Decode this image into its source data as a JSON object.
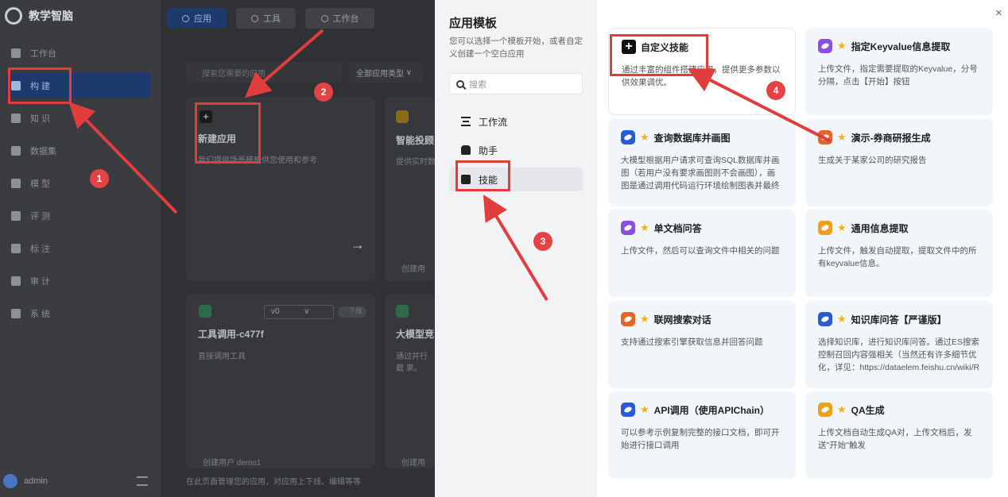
{
  "app": {
    "name": "教学智脑"
  },
  "sidebar": {
    "items": [
      {
        "label": "工作台",
        "icon": "cube-icon",
        "active": false
      },
      {
        "label": "构  建",
        "icon": "build-icon",
        "active": true
      },
      {
        "label": "知  识",
        "icon": "book-icon",
        "active": false
      },
      {
        "label": "数据集",
        "icon": "dataset-icon",
        "active": false
      },
      {
        "label": "模  型",
        "icon": "model-icon",
        "active": false
      },
      {
        "label": "评  测",
        "icon": "chart-icon",
        "active": false
      },
      {
        "label": "标  注",
        "icon": "tag-icon",
        "active": false
      },
      {
        "label": "审  计",
        "icon": "shield-icon",
        "active": false
      },
      {
        "label": "系  统",
        "icon": "gear-icon",
        "active": false
      }
    ],
    "user": "admin"
  },
  "top_tabs": [
    {
      "label": "应用",
      "active": true
    },
    {
      "label": "工具",
      "active": false
    },
    {
      "label": "工作台",
      "active": false
    }
  ],
  "background": {
    "search_placeholder": "搜索您需要的应用",
    "type_filter": "全部应用类型",
    "new_app_title": "新建应用",
    "new_app_desc": "我们提供场景模板供您使用和参考",
    "card2_title": "智能投顾",
    "card2_desc": "提供实时数",
    "card3_title": "工具调用-c477f",
    "card3_desc": "直接调用工具",
    "card3_version": "v0",
    "card3_toggle": "下线",
    "card4_title": "大模型竞",
    "card4_desc": "通过并行截 果。",
    "creator_1": "创建用",
    "creator_2": "创建用户 demo1",
    "creator_3": "创建用",
    "footer": "在此页面管理您的应用，对应用上下线、编辑等等"
  },
  "drawer": {
    "title": "应用模板",
    "subtitle": "您可以选择一个模板开始，或者自定义创建一个空白应用",
    "search_placeholder": "搜索",
    "categories": [
      {
        "label": "工作流",
        "active": false
      },
      {
        "label": "助手",
        "active": false
      },
      {
        "label": "技能",
        "active": true
      }
    ],
    "close_glyph": "×"
  },
  "templates": [
    {
      "title": "自定义技能",
      "desc": "通过丰富的组件搭建应用，提供更多参数以供效果调优。",
      "color": "#111111",
      "star": false,
      "custom": true
    },
    {
      "title": "指定Keyvalue信息提取",
      "desc": "上传文件，指定需要提取的Keyvalue，分号分隔，点击【开始】按钮",
      "color": "#8a4fe0",
      "star": true
    },
    {
      "title": "查询数据库并画图",
      "desc": "大模型根据用户请求可查询SQL数据库并画图（若用户没有要求画图则不会画图），画图是通过调用代码运行环境绘制图表并最终保",
      "color": "#2a5ad6",
      "star": true
    },
    {
      "title": "演示-券商研报生成",
      "desc": "生成关于某家公司的研究报告",
      "color": "#e0662a",
      "star": true
    },
    {
      "title": "单文档问答",
      "desc": "上传文件，然后可以查询文件中相关的问题",
      "color": "#8a4fe0",
      "star": true
    },
    {
      "title": "通用信息提取",
      "desc": "上传文件，触发自动提取，提取文件中的所有keyvalue信息。",
      "color": "#f0a020",
      "star": true
    },
    {
      "title": "联网搜索对话",
      "desc": "支持通过搜索引擎获取信息并回答问题",
      "color": "#e0662a",
      "star": true
    },
    {
      "title": "知识库问答【严谨版】",
      "desc": "选择知识库，进行知识库问答。通过ES搜索控制召回内容强相关（当然还有许多细节优化，详见：https://dataelem.feishu.cn/wiki/R",
      "color": "#2a5ad6",
      "star": true
    },
    {
      "title": "API调用（使用APIChain）",
      "desc": "可以参考示例复制完整的接口文档，即可开始进行接口调用",
      "color": "#2a5ad6",
      "star": true
    },
    {
      "title": "QA生成",
      "desc": "上传文档自动生成QA对，上传文档后，发送\"开始\"触发",
      "color": "#f0a020",
      "star": true
    }
  ],
  "annotations": {
    "badges": [
      "1",
      "2",
      "3",
      "4"
    ],
    "color": "#e23d3d"
  }
}
